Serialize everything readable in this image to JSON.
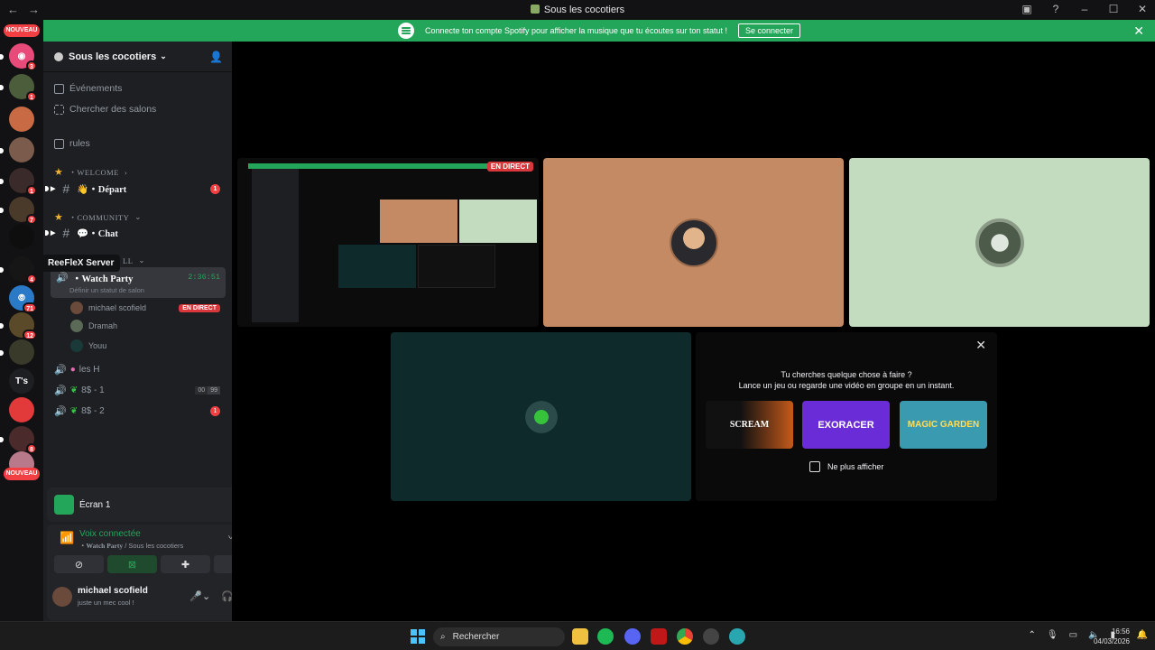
{
  "window": {
    "title": "Sous les cocotiers"
  },
  "guilds": {
    "nouveau_top": "NOUVEAU",
    "nouveau_bottom": "NOUVEAU",
    "tooltip": "ReeFleX Server",
    "text_guild": "T's",
    "badges": [
      "3",
      "1",
      "1",
      "7",
      "4",
      "71",
      "12",
      "8"
    ]
  },
  "banner": {
    "text": "Connecte ton compte Spotify pour afficher la musique que tu écoutes sur ton statut !",
    "button": "Se connecter"
  },
  "server": {
    "name": "Sous les cocotiers",
    "events": "Événements",
    "browse": "Chercher des salons",
    "rules": "rules",
    "cat_welcome": "・WELCOME",
    "chan_depart": "👋・Départ",
    "chan_depart_badge": "1",
    "cat_community": "・COMMUNITY",
    "chan_chat": "💬・Chat",
    "cat_hidden": "LL",
    "voice_watch": "・Watch Party",
    "voice_timer": "2:36:51",
    "voice_status": "Définir un statut de salon",
    "members": [
      {
        "name": "michael scofield",
        "live": "EN DIRECT"
      },
      {
        "name": "Dramah"
      },
      {
        "name": "Youu"
      }
    ],
    "voice_lesh": "les H",
    "voice_8s1": "8$ - 1",
    "voice_8s1_count_a": "00",
    "voice_8s1_count_b": "99",
    "voice_8s2": "8$ - 2",
    "voice_8s2_badge": "1"
  },
  "screen_share": {
    "label": "Écran 1"
  },
  "voice_conn": {
    "title": "Voix connectée",
    "channel": "・Watch Party",
    "server": " / Sous les cocotiers"
  },
  "user": {
    "name": "michael scofield",
    "status": "juste un mec cool !"
  },
  "stage": {
    "live_label": "EN DIRECT",
    "activity_q1": "Tu cherches quelque chose à faire ?",
    "activity_q2": "Lance un jeu ou regarde une vidéo en groupe en un instant.",
    "games": [
      "SCREAM",
      "EXORACER",
      "MAGIC GARDEN"
    ],
    "checkbox": "Ne plus afficher"
  },
  "taskbar": {
    "search": "Rechercher",
    "time": "16:56",
    "date": "04/03/2026"
  },
  "colors": {
    "green": "#23a55a",
    "red": "#f23f43",
    "tile_orange": "#c48a64",
    "tile_mint": "#c3dcbf",
    "tile_teal": "#0f2a2a"
  }
}
